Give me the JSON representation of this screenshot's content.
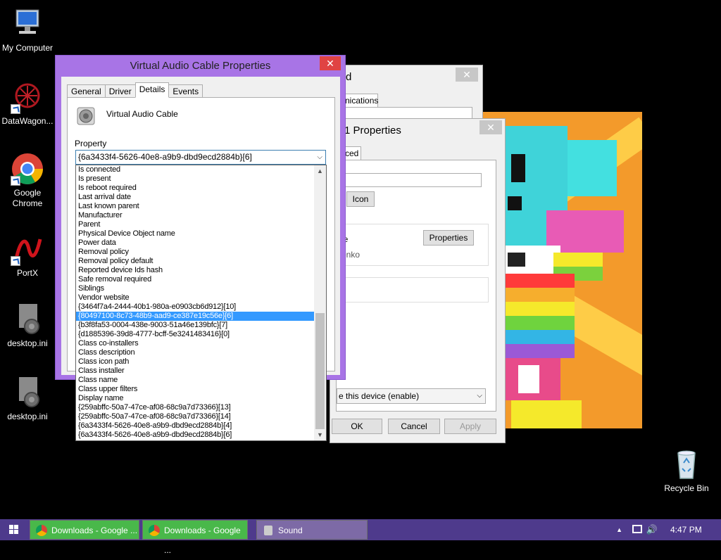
{
  "desktop": {
    "icons": [
      {
        "label": "My Computer"
      },
      {
        "label": "DataWagon..."
      },
      {
        "label": "Google Chrome"
      },
      {
        "label": "PortX"
      },
      {
        "label": "desktop.ini"
      },
      {
        "label": "desktop.ini"
      },
      {
        "label": "Recycle Bin"
      }
    ]
  },
  "back_window_1": {
    "title_fragment": "d",
    "tab_fragment": "nications"
  },
  "back_window_2": {
    "title_fragment": "1 Properties",
    "tab_fragment": "ced",
    "icon_button": "Icon",
    "properties_button": "Properties",
    "text_le": "le",
    "text_enko": "enko",
    "text_k": "k",
    "device_usage_select": "e this device (enable)",
    "ok_label": "OK",
    "cancel_label": "Cancel",
    "apply_label": "Apply"
  },
  "dialog": {
    "title": "Virtual Audio Cable Properties",
    "close_glyph": "✕",
    "tabs": [
      "General",
      "Driver",
      "Details",
      "Events"
    ],
    "device_name": "Virtual Audio Cable",
    "property_label": "Property",
    "property_selected": "{6a3433f4-5626-40e8-a9b9-dbd9ecd2884b}[6]"
  },
  "dropdown": {
    "items": [
      "Is connected",
      "Is present",
      "Is reboot required",
      "Last arrival date",
      "Last known parent",
      "Manufacturer",
      "Parent",
      "Physical Device Object name",
      "Power data",
      "Removal policy",
      "Removal policy default",
      "Reported device Ids hash",
      "Safe removal required",
      "Siblings",
      "Vendor website",
      "{3464f7a4-2444-40b1-980a-e0903cb6d912}[10]",
      "{80497100-8c73-48b9-aad9-ce387e19c56e}[6]",
      "{b3f8fa53-0004-438e-9003-51a46e139bfc}[7]",
      "{d1885396-39d8-4777-bcff-5e3241483416}[0]",
      "Class co-installers",
      "Class description",
      "Class icon path",
      "Class installer",
      "Class name",
      "Class upper filters",
      "Display name",
      "{259abffc-50a7-47ce-af08-68c9a7d73366}[13]",
      "{259abffc-50a7-47ce-af08-68c9a7d73366}[14]",
      "{6a3433f4-5626-40e8-a9b9-dbd9ecd2884b}[4]",
      "{6a3433f4-5626-40e8-a9b9-dbd9ecd2884b}[6]"
    ],
    "selected_item": "{80497100-8c73-48b9-aad9-ce387e19c56e}[6]"
  },
  "taskbar": {
    "tasks": [
      {
        "label": "Downloads - Google ..."
      },
      {
        "label": "Downloads - Google ..."
      },
      {
        "label": "Sound"
      }
    ],
    "time": "4:47 PM"
  },
  "colors": {
    "dialog_frame": "#a874e6",
    "taskbar": "#4e3a8c",
    "selection": "#3399ff",
    "close_red": "#e04343"
  }
}
